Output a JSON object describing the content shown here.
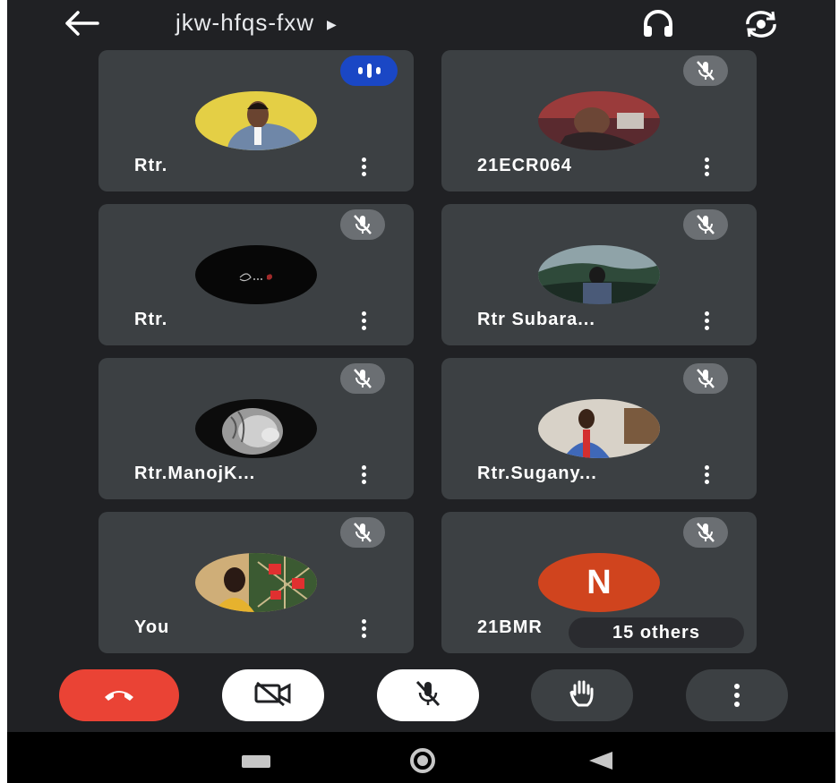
{
  "header": {
    "meeting_code": "jkw-hfqs-fxw",
    "back_icon": "arrow-left-icon",
    "caret_icon": "play-caret-icon",
    "audio_icon": "headphones-icon",
    "flip_camera_icon": "flip-camera-icon"
  },
  "participants": [
    {
      "name": "Rtr.",
      "status": "speaking",
      "avatar": "photo"
    },
    {
      "name": "21ECR064",
      "status": "muted",
      "avatar": "photo"
    },
    {
      "name": "Rtr.",
      "status": "muted",
      "avatar": "photo"
    },
    {
      "name": "Rtr Subara...",
      "status": "muted",
      "avatar": "photo"
    },
    {
      "name": "Rtr.ManojK...",
      "status": "muted",
      "avatar": "photo"
    },
    {
      "name": "Rtr.Sugany...",
      "status": "muted",
      "avatar": "photo"
    },
    {
      "name": "You",
      "status": "muted",
      "avatar": "photo"
    },
    {
      "name": "21BMR",
      "status": "muted",
      "avatar": "letter",
      "initial": "N"
    }
  ],
  "others_label": "15 others",
  "controls": [
    {
      "name": "end-call",
      "icon": "phone-hangup-icon",
      "color": "#ea4335"
    },
    {
      "name": "camera-off",
      "icon": "video-off-icon",
      "color": "#ffffff"
    },
    {
      "name": "mic-off",
      "icon": "mic-off-icon",
      "color": "#ffffff"
    },
    {
      "name": "raise-hand",
      "icon": "hand-icon",
      "color": "#3c4043"
    },
    {
      "name": "more-options",
      "icon": "more-vert-icon",
      "color": "#3c4043"
    }
  ],
  "colors": {
    "background": "#202124",
    "tile": "#3c4043",
    "speaking": "#1a47c5",
    "end_call": "#ea4335",
    "letter_avatar": "#d0441e"
  }
}
